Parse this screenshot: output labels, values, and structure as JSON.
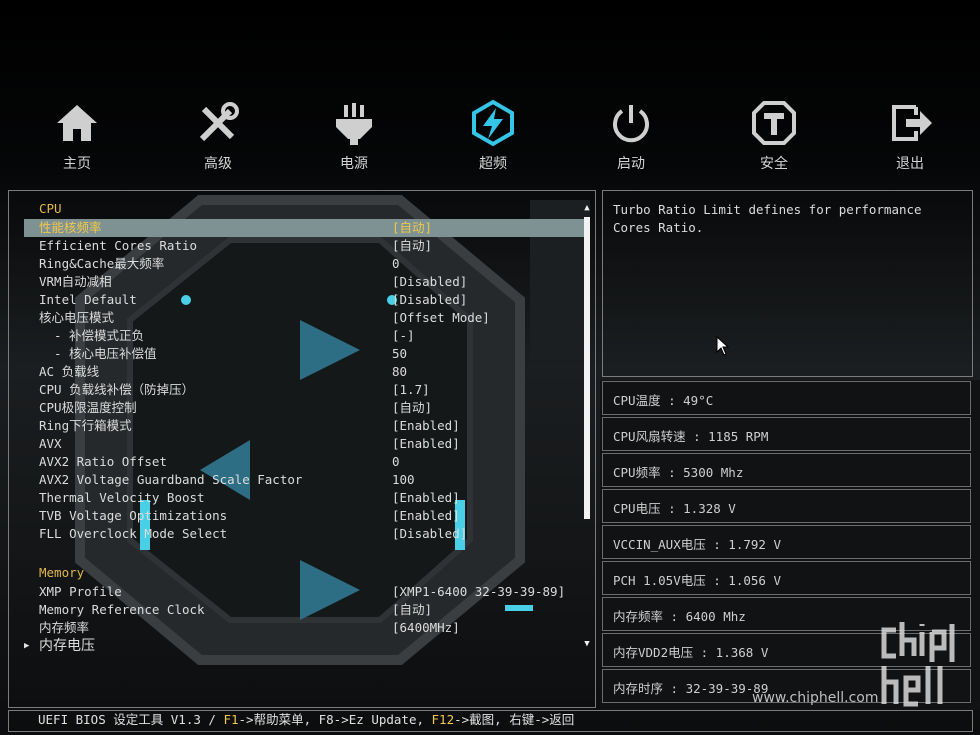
{
  "nav": {
    "items": [
      {
        "label": "主页",
        "icon": "home-icon"
      },
      {
        "label": "高级",
        "icon": "tools-icon"
      },
      {
        "label": "电源",
        "icon": "power-plug-icon"
      },
      {
        "label": "超频",
        "icon": "overclock-bolt-icon",
        "active": true
      },
      {
        "label": "启动",
        "icon": "power-button-icon"
      },
      {
        "label": "安全",
        "icon": "shield-icon"
      },
      {
        "label": "退出",
        "icon": "exit-icon"
      }
    ]
  },
  "settings": {
    "cpu_header": "CPU",
    "rows": [
      {
        "label": "性能核频率",
        "value": "[自动]"
      },
      {
        "label": "Efficient Cores Ratio",
        "value": "[自动]"
      },
      {
        "label": "Ring&Cache最大频率",
        "value": "0"
      },
      {
        "label": "VRM自动减相",
        "value": "[Disabled]"
      },
      {
        "label": "Intel Default",
        "value": "[Disabled]"
      },
      {
        "label": "核心电压模式",
        "value": "[Offset Mode]"
      },
      {
        "label": "- 补偿模式正负",
        "value": "[-]"
      },
      {
        "label": "- 核心电压补偿值",
        "value": "50"
      },
      {
        "label": "AC 负载线",
        "value": "80"
      },
      {
        "label": "CPU 负载线补偿（防掉压）",
        "value": "[1.7]"
      },
      {
        "label": "CPU极限温度控制",
        "value": "[自动]"
      },
      {
        "label": "Ring下行箱模式",
        "value": "[Enabled]"
      },
      {
        "label": "AVX",
        "value": "[Enabled]"
      },
      {
        "label": "AVX2 Ratio Offset",
        "value": "0"
      },
      {
        "label": "AVX2 Voltage Guardband Scale Factor",
        "value": "100"
      },
      {
        "label": "Thermal Velocity Boost",
        "value": "[Enabled]"
      },
      {
        "label": "TVB Voltage Optimizations",
        "value": "[Enabled]"
      },
      {
        "label": "FLL Overclock Mode Select",
        "value": "[Disabled]"
      }
    ],
    "memory_header": "Memory",
    "memory_rows": [
      {
        "label": "XMP Profile",
        "value": "[XMP1-6400 32-39-39-89]"
      },
      {
        "label": "Memory Reference Clock",
        "value": "[自动]"
      },
      {
        "label": "内存频率",
        "value": "[6400MHz]"
      },
      {
        "label": "内存电压",
        "value": ""
      }
    ],
    "submenu_marker": "▶",
    "scroll_up": "▲",
    "scroll_down": "▼"
  },
  "help": {
    "text": "Turbo Ratio Limit defines for performance Cores Ratio."
  },
  "info": [
    "CPU温度 : 49°C",
    "CPU风扇转速 : 1185 RPM",
    "CPU频率 : 5300 Mhz",
    "CPU电压 : 1.328 V",
    "VCCIN_AUX电压 : 1.792 V",
    "PCH 1.05V电压 : 1.056 V",
    "内存频率 : 6400 Mhz",
    "内存VDD2电压 : 1.368 V",
    "内存时序 : 32-39-39-89"
  ],
  "footer": {
    "prefix": "UEFI BIOS 设定工具 V1.3 / ",
    "f1": "F1",
    "f1_text": "->帮助菜单, F8->Ez Update, ",
    "f12": "F12",
    "f12_text": "->截图, 右键->返回"
  },
  "watermark": {
    "logo": "chip hell",
    "url": "www.chiphell.com"
  },
  "colors": {
    "accent_yellow": "#f0c84a",
    "selected_bg": "#7f9293",
    "active_icon": "#35c5e8"
  }
}
